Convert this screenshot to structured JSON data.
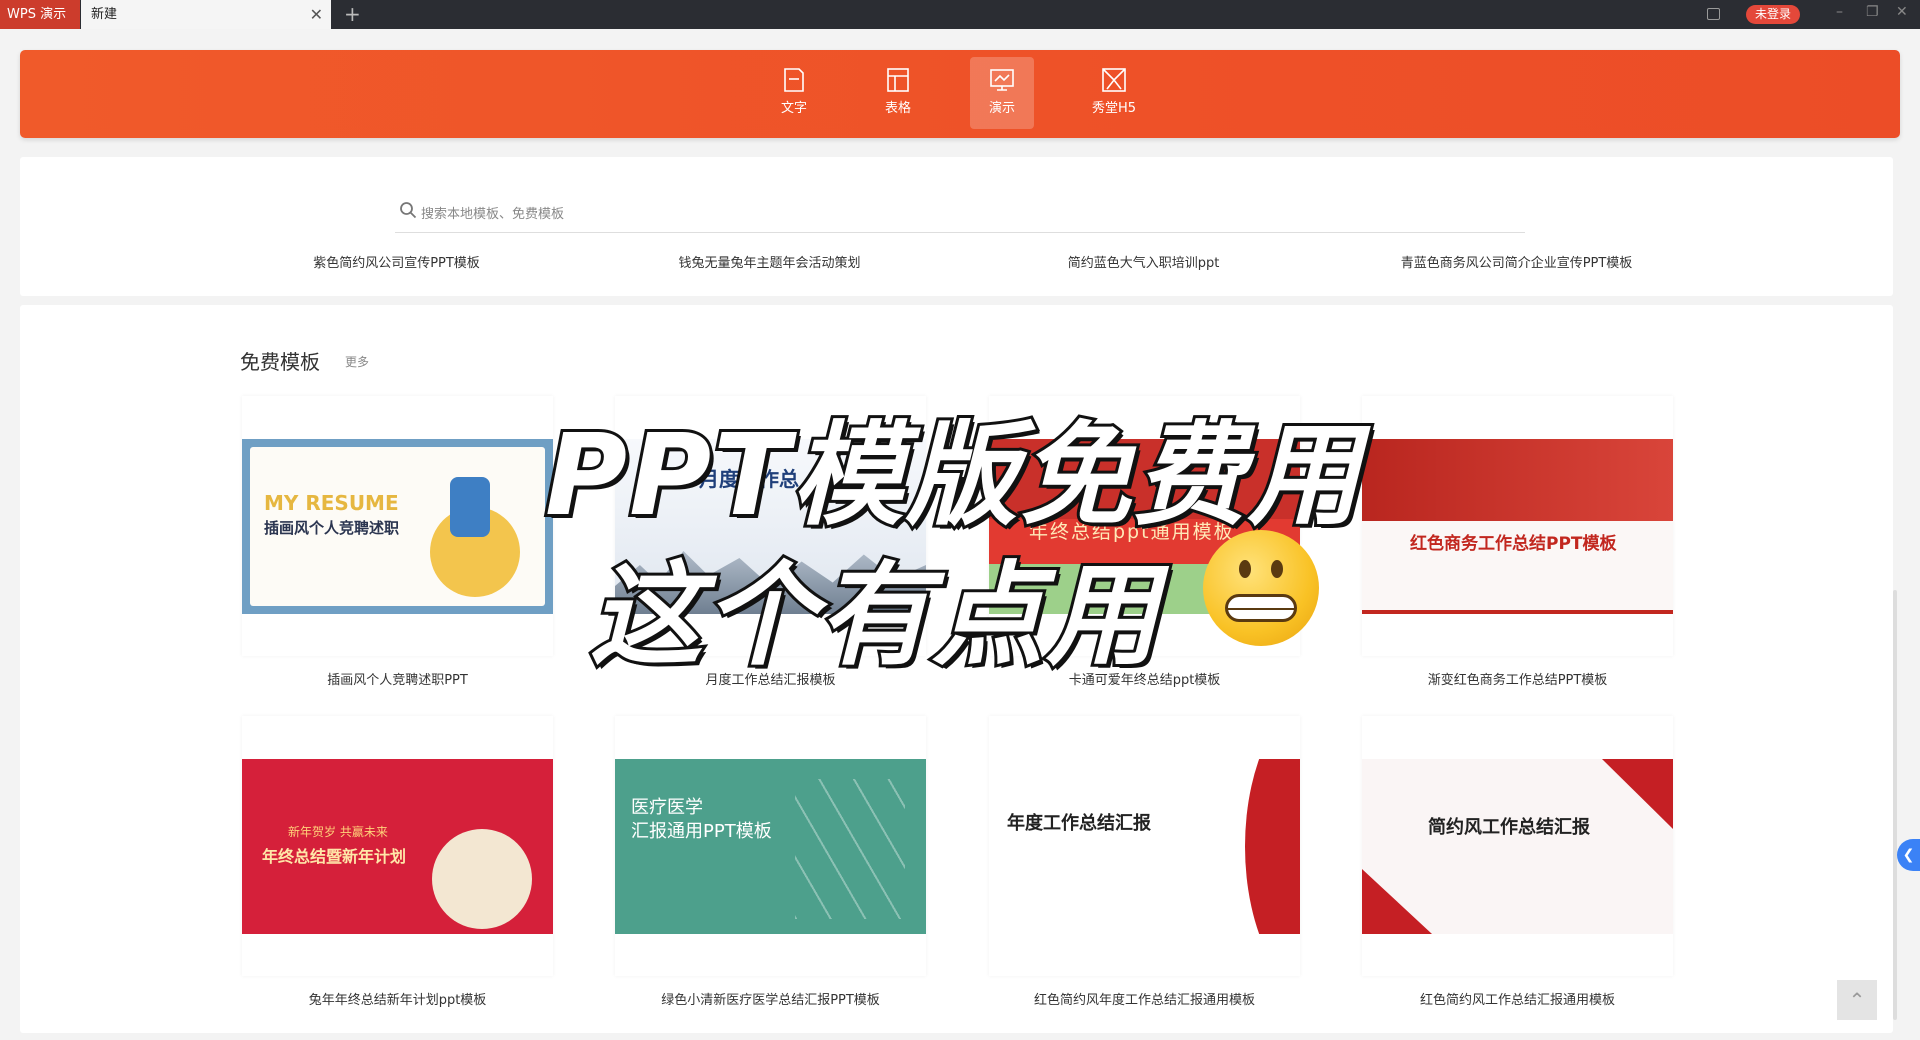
{
  "titlebar": {
    "app_label": "WPS 演示",
    "tab_label": "新建",
    "login_label": "未登录"
  },
  "categories": [
    {
      "label": "文字",
      "icon": "document-icon"
    },
    {
      "label": "表格",
      "icon": "table-icon"
    },
    {
      "label": "演示",
      "icon": "presentation-icon",
      "active": true
    },
    {
      "label": "秀堂H5",
      "icon": "h5-icon"
    }
  ],
  "search": {
    "placeholder": "搜索本地模板、免费模板"
  },
  "top_row": [
    "紫色简约风公司宣传PPT模板",
    "钱兔无量兔年主题年会活动策划",
    "简约蓝色大气入职培训ppt",
    "青蓝色商务风公司简介企业宣传PPT模板"
  ],
  "free_section": {
    "title": "免费模板",
    "more_label": "更多",
    "templates": [
      {
        "name": "插画风个人竞聘述职PPT",
        "thumb_text": [
          "MY RESUME",
          "插画风个人竞聘述职"
        ]
      },
      {
        "name": "月度工作总结汇报模板",
        "thumb_text": [
          "月度工作总"
        ]
      },
      {
        "name": "卡通可爱年终总结ppt模板",
        "thumb_text": [
          "年终总结ppt通用模板"
        ]
      },
      {
        "name": "渐变红色商务工作总结PPT模板",
        "thumb_text": [
          "红色商务工作总结PPT模板"
        ]
      },
      {
        "name": "兔年年终总结新年计划ppt模板",
        "thumb_text": [
          "新年贺岁 共赢未来",
          "年终总结暨新年计划"
        ]
      },
      {
        "name": "绿色小清新医疗医学总结汇报PPT模板",
        "thumb_text": [
          "医疗医学",
          "汇报通用PPT模板"
        ]
      },
      {
        "name": "红色简约风年度工作总结汇报通用模板",
        "thumb_text": [
          "年度工作总结汇报"
        ]
      },
      {
        "name": "红色简约风工作总结汇报通用模板",
        "thumb_text": [
          "简约风工作总结汇报"
        ]
      }
    ]
  },
  "overlay": {
    "line1": "PPT模版免费用",
    "line2": "这个有点用"
  },
  "colors": {
    "brand_orange": "#EE5128",
    "login_red": "#E4483A",
    "accent_blue": "#3B82F6"
  }
}
